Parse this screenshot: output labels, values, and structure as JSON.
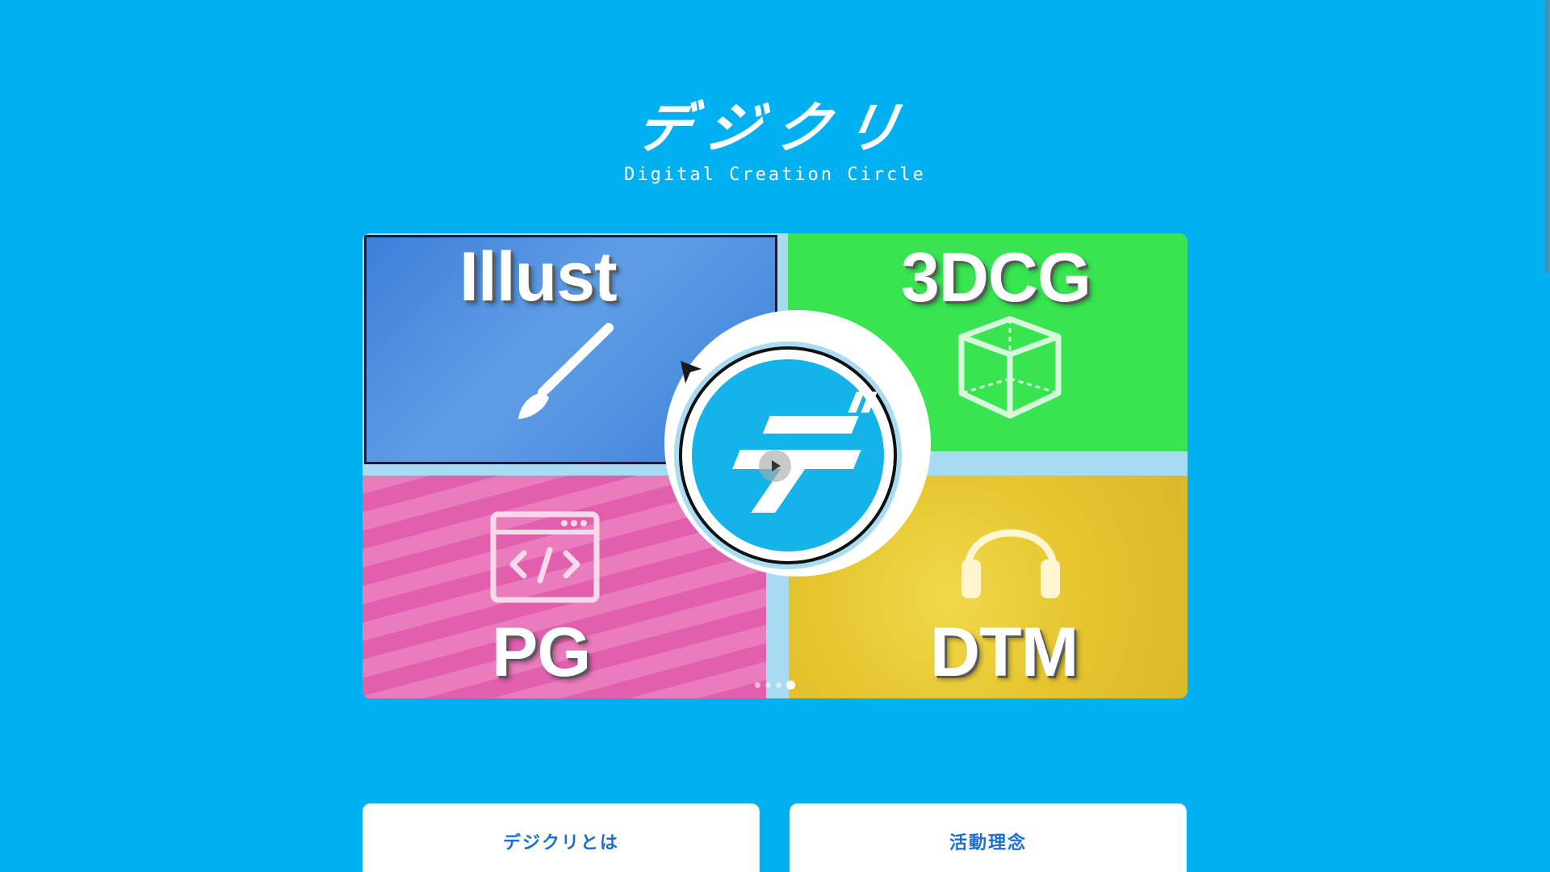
{
  "logo": {
    "jp_text": "デジクリ",
    "en_text": "Digital Creation Circle"
  },
  "hero": {
    "quadrants": [
      {
        "label": "Illust",
        "icon": "paintbrush-icon",
        "color": "#3d7fd9"
      },
      {
        "label": "3DCG",
        "icon": "cube-icon",
        "color": "#38e551"
      },
      {
        "label": "PG",
        "icon": "code-window-icon",
        "color": "#e25fae"
      },
      {
        "label": "DTM",
        "icon": "headphones-icon",
        "color": "#e6c52e"
      }
    ],
    "center_logo_text": "デ",
    "carousel_active_index": 3,
    "carousel_count": 4
  },
  "cards": [
    {
      "label": "デジクリとは"
    },
    {
      "label": "活動理念"
    }
  ],
  "colors": {
    "background": "#00b0f0",
    "card_text": "#1c6fd1"
  }
}
